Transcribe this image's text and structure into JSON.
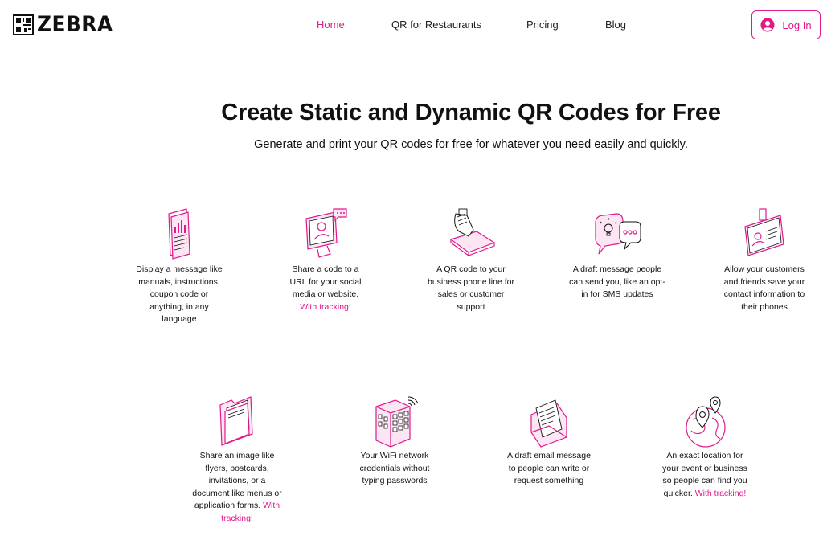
{
  "brand": {
    "name": "ZEBRA",
    "accent": "#e0198c"
  },
  "nav": {
    "items": [
      "Home",
      "QR for Restaurants",
      "Pricing",
      "Blog"
    ],
    "active": "Home",
    "login_label": "Log In"
  },
  "hero": {
    "title": "Create Static and Dynamic QR Codes for Free",
    "subtitle": "Generate and print your QR codes for free for whatever you need easily and quickly."
  },
  "features": [
    {
      "icon": "document-chart-icon",
      "text": "Display a message like manuals, instructions, coupon code or anything, in any language",
      "highlight": ""
    },
    {
      "icon": "monitor-user-icon",
      "text": "Share a code to a URL for your social media or website.",
      "highlight": "With tracking!"
    },
    {
      "icon": "hand-phone-icon",
      "text": "A QR code  to your business phone line for sales or customer support",
      "highlight": ""
    },
    {
      "icon": "chat-bubbles-icon",
      "text": "A draft message people can send you, like an opt-in for SMS updates",
      "highlight": ""
    },
    {
      "icon": "contact-card-icon",
      "text": "Allow your customers and friends save your contact information to their phones",
      "highlight": ""
    },
    {
      "icon": "folder-icon",
      "text": "Share an image like flyers, postcards, invitations, or a document like menus or application forms.",
      "highlight": "With tracking!"
    },
    {
      "icon": "wifi-building-icon",
      "text": "Your WiFi network credentials without typing passwords",
      "highlight": ""
    },
    {
      "icon": "email-envelope-icon",
      "text": "A draft email message to people can write or request something",
      "highlight": ""
    },
    {
      "icon": "map-pin-globe-icon",
      "text": "An exact location for your event or business so people can find you quicker.",
      "highlight": "With tracking!"
    }
  ]
}
